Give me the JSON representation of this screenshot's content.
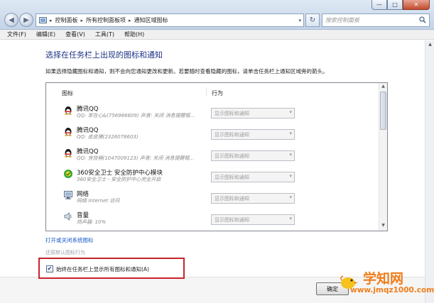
{
  "window": {
    "min_glyph": "—",
    "max_glyph": "□",
    "close_glyph": "✕"
  },
  "address": {
    "crumbs": [
      "控制面板",
      "所有控制面板项",
      "通知区域图标"
    ],
    "separator": "▸",
    "dropdown_glyph": "▾",
    "refresh_glyph": "↻",
    "search_placeholder": "搜索控制面板"
  },
  "nav": {
    "back_glyph": "◀",
    "forward_glyph": "▶"
  },
  "menu": [
    "文件(F)",
    "编辑(E)",
    "查看(V)",
    "工具(T)",
    "帮助(H)"
  ],
  "page": {
    "title": "选择在任务栏上出现的图标和通知",
    "description": "如果选择隐藏图标和通知，则不会向您通知更改和更新。若要随时查看隐藏的图标，请单击任务栏上通知区域旁的箭头。"
  },
  "table": {
    "col_icons": "图标",
    "col_behavior": "行为",
    "rows": [
      {
        "icon": "qq-penguin-icon",
        "name": "腾讯QQ",
        "sub": "QQ: 笨在心&(756966609) 声音: 关闭 消息提醒框...",
        "behavior": "显示图标和通知"
      },
      {
        "icon": "qq-penguin-icon",
        "name": "腾讯QQ",
        "sub": "QQ: 皮皮猪(2326078603)",
        "behavior": "显示图标和通知"
      },
      {
        "icon": "qq-penguin-icon",
        "name": "腾讯QQ",
        "sub": "QQ: 宫技萌(1047009123) 声音: 关闭 消息提醒框...",
        "behavior": "显示图标和通知"
      },
      {
        "icon": "360-shield-icon",
        "name": "360安全卫士 安全防护中心模块",
        "sub": "360安全卫士 - 安全防护中心完全开启",
        "behavior": "显示图标和通知"
      },
      {
        "icon": "network-icon",
        "name": "网络",
        "sub": "网络 Internet 访问",
        "behavior": "显示图标和通知"
      },
      {
        "icon": "volume-icon",
        "name": "音量",
        "sub": "扬声器: 10%",
        "behavior": "显示图标和通知"
      }
    ],
    "dropdown_glyph": "▾"
  },
  "links": {
    "system_icons": "打开或关闭系统图标",
    "restore_defaults": "还原默认图标行为"
  },
  "always_show": {
    "label": "始终在任务栏上显示所有图标和通知(A)",
    "checked": true,
    "check_glyph": "✔"
  },
  "buttons": {
    "ok": "确定"
  },
  "scroll": {
    "up_glyph": "▲",
    "down_glyph": "▼"
  },
  "watermark": {
    "logo_text": "学知网",
    "url": "www.jmqz1000.com"
  },
  "colors": {
    "title_blue": "#1e3287",
    "link_blue": "#1a58c7",
    "highlight_red": "#c9232d",
    "watermark_orange": "#f07d1a"
  }
}
